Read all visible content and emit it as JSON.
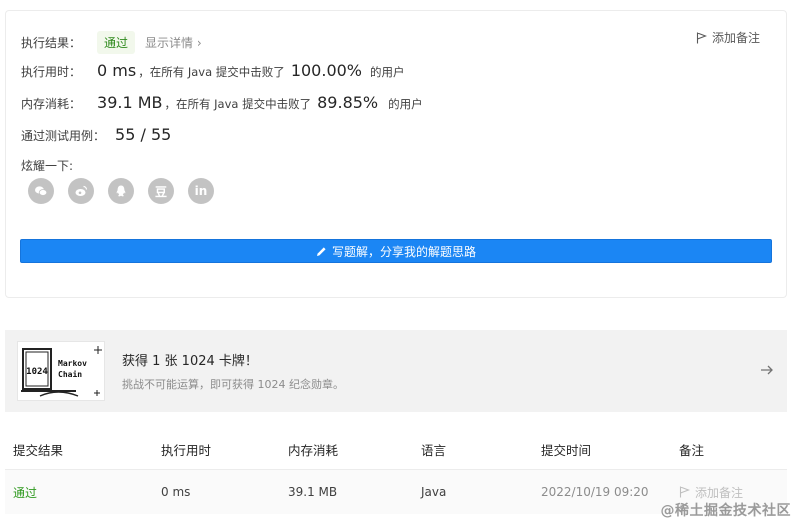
{
  "result": {
    "status_label": "执行结果：",
    "status_value": "通过",
    "detail_link": "显示详情",
    "detail_chevron": "›",
    "add_note": "添加备注",
    "runtime": {
      "label": "执行用时：",
      "value": "0 ms",
      "mid_text": "，在所有 Java 提交中击败了",
      "percent": "100.00%",
      "suffix": "的用户"
    },
    "memory": {
      "label": "内存消耗：",
      "value": "39.1 MB",
      "mid_text": "，在所有 Java 提交中击败了",
      "percent": "89.85%",
      "suffix": "的用户"
    },
    "tests": {
      "label": "通过测试用例：",
      "value": "55 / 55"
    },
    "share_label": "炫耀一下:",
    "share_icons": [
      "wechat-icon",
      "weibo-icon",
      "qq-icon",
      "douban-icon",
      "linkedin-icon"
    ],
    "share_glyphs": {
      "douban": "豆",
      "linkedin": "in"
    },
    "solution_button": "写题解，分享我的解题思路"
  },
  "promo": {
    "image_text_top": "Markov",
    "image_text_bottom": "Chain",
    "image_number": "1024",
    "title": "获得 1 张 1024 卡牌！",
    "subtitle": "挑战不可能运算，即可获得 1024 纪念勋章。"
  },
  "table": {
    "headers": [
      "提交结果",
      "执行用时",
      "内存消耗",
      "语言",
      "提交时间",
      "备注"
    ],
    "rows": [
      {
        "status": "通过",
        "runtime": "0 ms",
        "memory": "39.1 MB",
        "language": "Java",
        "time": "2022/10/19 09:20",
        "note": "添加备注"
      }
    ]
  },
  "watermark": "@稀土掘金技术社区",
  "colors": {
    "accent": "#1b86f4",
    "pass_green": "#2f8a1d",
    "icon_gray": "#c3c3c3"
  }
}
